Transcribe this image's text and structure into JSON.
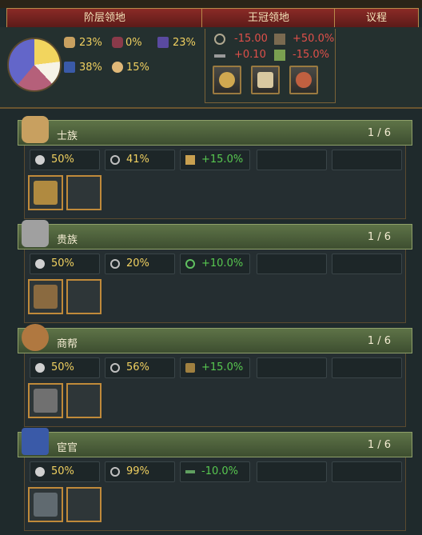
{
  "tabs": {
    "estates": "阶层领地",
    "crown": "王冠领地",
    "parliament": "议程"
  },
  "pie": {
    "colors": [
      "#f2d55e",
      "#f6f3e6",
      "#b5607a",
      "#6366c9"
    ]
  },
  "estate_land": [
    {
      "icon": "prayer-hands-icon",
      "value": "23%"
    },
    {
      "icon": "noble-armor-icon",
      "value": "0%"
    },
    {
      "icon": "merchant-hat-icon",
      "value": "23%"
    },
    {
      "icon": "eunuch-scroll-icon",
      "value": "38%"
    },
    {
      "icon": "jar-icon",
      "value": "15%"
    }
  ],
  "crown": {
    "row1": [
      {
        "icon": "chain-icon",
        "value": "-15.00"
      },
      {
        "icon": "goods-icon",
        "value": "+50.0%"
      }
    ],
    "row2": [
      {
        "icon": "sword-icon",
        "value": "+0.10"
      },
      {
        "icon": "trade-icon",
        "value": "-15.0%"
      }
    ],
    "buttons": [
      "money-bag-button",
      "decree-button",
      "sword-grant-button"
    ]
  },
  "estates": [
    {
      "name": "士族",
      "count": "1 / 6",
      "loyalty": "50%",
      "influence": "41%",
      "bonus": "+15.0%",
      "icon": "scholar-hands-icon",
      "color": "#c8a060"
    },
    {
      "name": "贵族",
      "count": "1 / 6",
      "loyalty": "50%",
      "influence": "20%",
      "bonus": "+10.0%",
      "icon": "noble-armor-icon",
      "color": "#a0a0a0"
    },
    {
      "name": "商帮",
      "count": "1 / 6",
      "loyalty": "50%",
      "influence": "56%",
      "bonus": "+15.0%",
      "icon": "merchant-hat-icon",
      "color": "#b07840"
    },
    {
      "name": "宦官",
      "count": "1 / 6",
      "loyalty": "50%",
      "influence": "99%",
      "bonus": "-10.0%",
      "icon": "eunuch-book-icon",
      "color": "#3a5aa8"
    }
  ]
}
